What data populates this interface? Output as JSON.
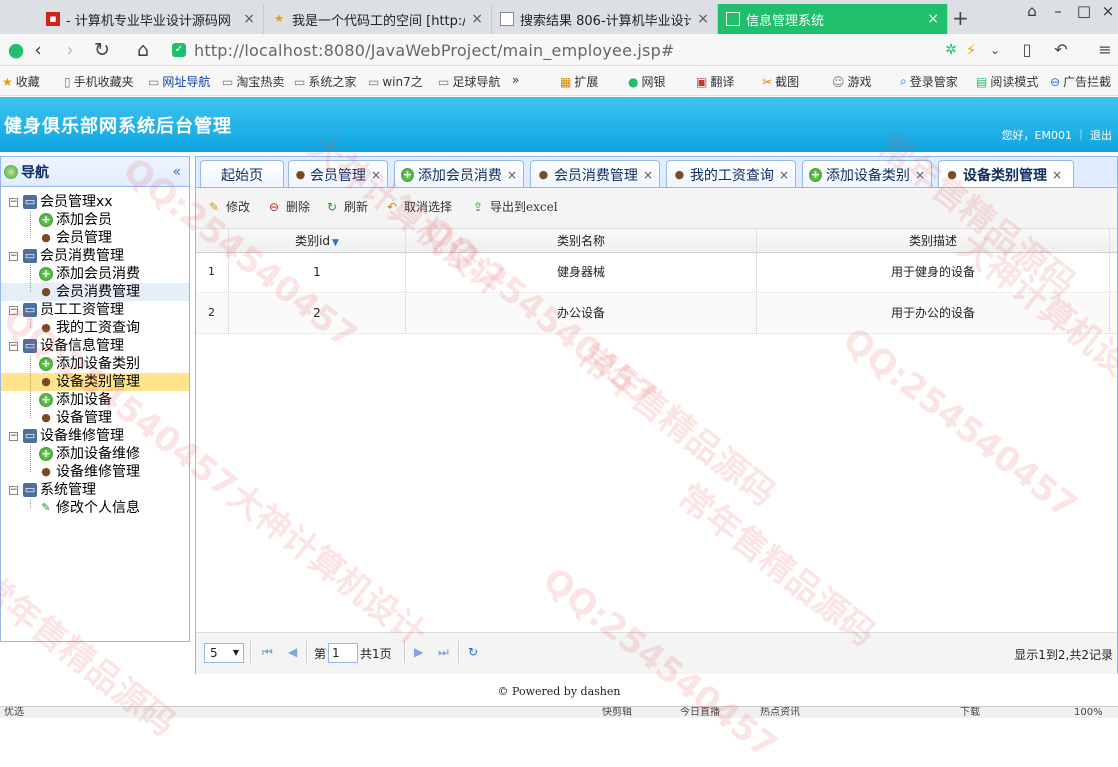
{
  "browser": {
    "tabs": [
      {
        "title": "- 计算机专业毕业设计源码网",
        "icon": "red-flag-icon"
      },
      {
        "title": "我是一个代码工的空间 [http://",
        "icon": "star-icon"
      },
      {
        "title": "搜索结果 806-计算机毕业设计",
        "icon": "page-icon"
      },
      {
        "title": "信息管理系统",
        "icon": "page-icon",
        "active": true
      }
    ],
    "url_host": "http://localhost",
    "url_path": ":8080/JavaWebProject/main_employee.jsp#",
    "bookmarks": [
      "收藏",
      "手机收藏夹",
      "网址导航",
      "淘宝热卖",
      "系统之家",
      "win7之",
      "足球导航",
      "»",
      "扩展",
      "网银",
      "翻译",
      "截图",
      "游戏",
      "登录管家",
      "阅读模式",
      "广告拦截"
    ],
    "colors": {
      "active_tab": "#1fbf6c"
    }
  },
  "app": {
    "title": "健身俱乐部网系统后台管理",
    "user_info": "您好，EM001 ｜ 退出",
    "header_color": "#0ea5e0"
  },
  "nav": {
    "title": "导航",
    "collapse": "«",
    "tree": [
      {
        "label": "会员管理xx",
        "children": [
          "添加会员",
          "会员管理"
        ]
      },
      {
        "label": "会员消费管理",
        "children": [
          "添加会员消费",
          "会员消费管理"
        ]
      },
      {
        "label": "员工工资管理",
        "children": [
          "我的工资查询"
        ]
      },
      {
        "label": "设备信息管理",
        "children": [
          "添加设备类别",
          "设备类别管理",
          "添加设备",
          "设备管理"
        ]
      },
      {
        "label": "设备维修管理",
        "children": [
          "添加设备维修",
          "设备维修管理"
        ]
      },
      {
        "label": "系统管理",
        "children": [
          "修改个人信息"
        ]
      }
    ]
  },
  "tabs": [
    {
      "label": "起始页"
    },
    {
      "label": "会员管理"
    },
    {
      "label": "添加会员消费"
    },
    {
      "label": "会员消费管理"
    },
    {
      "label": "我的工资查询"
    },
    {
      "label": "添加设备类别"
    },
    {
      "label": "设备类别管理",
      "active": true
    }
  ],
  "toolbar": {
    "edit": "修改",
    "delete": "删除",
    "refresh": "刷新",
    "cancel_select": "取消选择",
    "export": "导出到excel"
  },
  "grid": {
    "columns": [
      "类别id",
      "类别名称",
      "类别描述"
    ],
    "rows": [
      {
        "num": "1",
        "id": "1",
        "name": "健身器械",
        "desc": "用于健身的设备"
      },
      {
        "num": "2",
        "id": "2",
        "name": "办公设备",
        "desc": "用于办公的设备"
      }
    ]
  },
  "pager": {
    "page_size": "5",
    "page_prefix": "第",
    "page_value": "1",
    "page_total": "共1页",
    "summary": "显示1到2,共2记录"
  },
  "footer": "© Powered by dashen",
  "statusbar": [
    "优选",
    "快剪辑",
    "今日直播",
    "热点资讯",
    "下载",
    "100%"
  ],
  "watermarks": [
    "大神计算机设计",
    "QQ:254540457",
    "常年售精品源码"
  ]
}
